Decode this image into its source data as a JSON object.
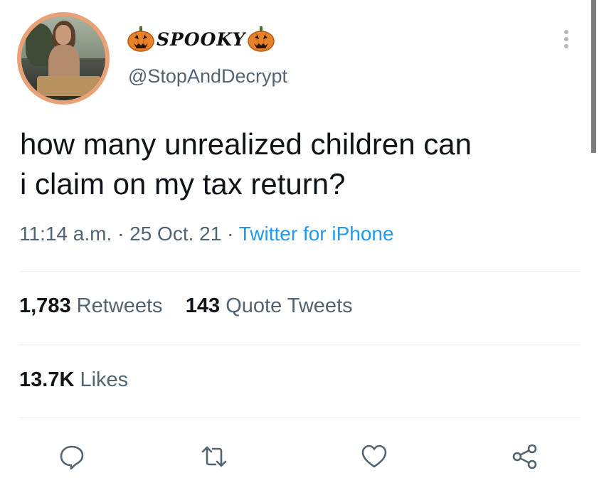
{
  "tweet": {
    "display_name": "SPOOKY",
    "handle": "@StopAndDecrypt",
    "text_line1": "how many unrealized children can",
    "text_line2": "i claim on my tax return?",
    "time": "11:14 a.m.",
    "separator": "·",
    "date": "25 Oct. 21",
    "source": "Twitter for iPhone"
  },
  "stats": {
    "retweets_count": "1,783",
    "retweets_label": "Retweets",
    "quotes_count": "143",
    "quotes_label": "Quote Tweets",
    "likes_count": "13.7K",
    "likes_label": "Likes"
  },
  "icons": {
    "display_name_emoji": "pumpkin-icon",
    "more": "more-options-icon",
    "reply": "reply-icon",
    "retweet": "retweet-icon",
    "like": "like-icon",
    "share": "share-icon"
  },
  "colors": {
    "avatar_ring": "#e9a278",
    "source_link": "#1d9bf0",
    "secondary_text": "#536471",
    "primary_text": "#0f1419",
    "pumpkin": "#e8822a"
  }
}
